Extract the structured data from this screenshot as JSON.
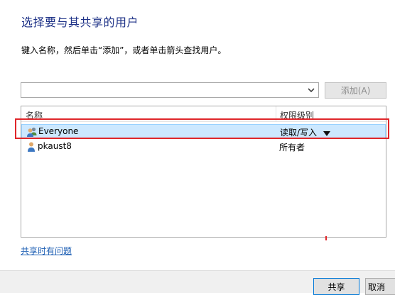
{
  "dialog": {
    "title": "选择要与其共享的用户",
    "instruction": "键入名称，然后单击“添加”，或者单击箭头查找用户。",
    "combo_value": "",
    "add_button": "添加(A)"
  },
  "list": {
    "headers": {
      "name": "名称",
      "permission": "权限级别"
    },
    "rows": [
      {
        "name": "Everyone",
        "permission": "读取/写入",
        "icon": "group-users-icon",
        "selected": true
      },
      {
        "name": "pkaust8",
        "permission": "所有者",
        "icon": "user-icon",
        "selected": false
      }
    ]
  },
  "link": {
    "trouble": "共享时有问题"
  },
  "footer": {
    "share_button": "共享",
    "cancel_button": "取消"
  },
  "colors": {
    "title": "#1e3287",
    "link": "#1e5fb4",
    "selection": "#cce8ff",
    "highlight": "#e0262a"
  }
}
